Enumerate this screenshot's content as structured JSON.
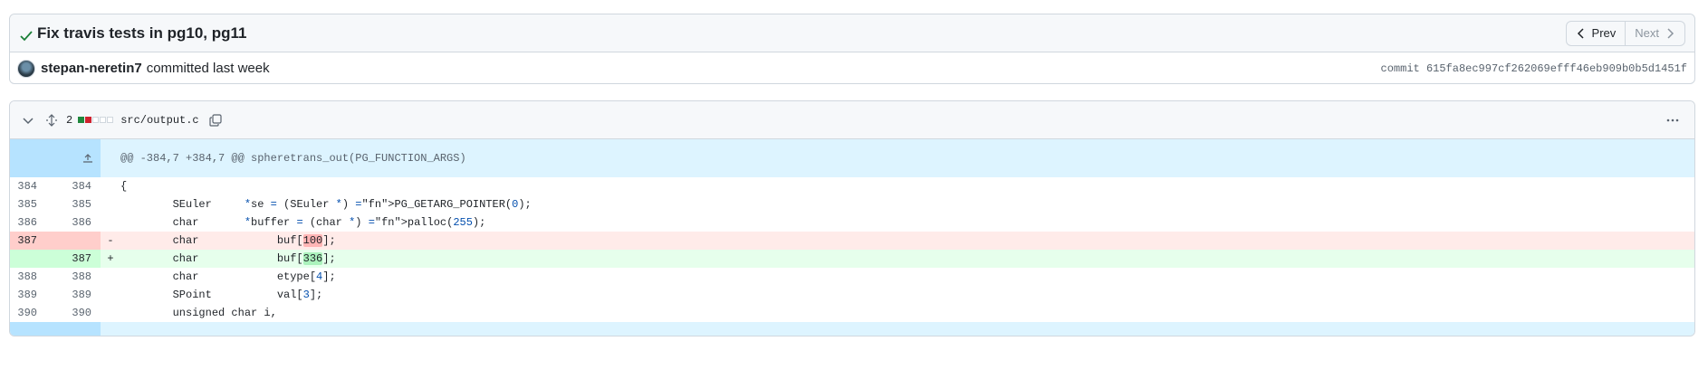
{
  "commit": {
    "title": "Fix travis tests in pg10, pg11",
    "prev_label": "Prev",
    "next_label": "Next",
    "author": "stepan-neretin7",
    "committed_text": "committed last week",
    "sha_label": "commit 615fa8ec997cf262069efff46eb909b0b5d1451f"
  },
  "file": {
    "change_count": "2",
    "name": "src/output.c",
    "diffstat": [
      "add",
      "del",
      "neutral",
      "neutral",
      "neutral"
    ]
  },
  "colors": {
    "add": "#1f883d",
    "del": "#cf222e",
    "neutral": "#d0d7de",
    "hunk_bg": "#ddf4ff",
    "check": "#1a7f37"
  },
  "diff": {
    "hunk_header": "@@ -384,7 +384,7 @@ spheretrans_out(PG_FUNCTION_ARGS)",
    "lines": [
      {
        "type": "ctx",
        "old": "384",
        "new": "384",
        "marker": "",
        "code": "{"
      },
      {
        "type": "ctx",
        "old": "385",
        "new": "385",
        "marker": "",
        "code": "        SEuler     *se = (SEuler *) PG_GETARG_POINTER(0);"
      },
      {
        "type": "ctx",
        "old": "386",
        "new": "386",
        "marker": "",
        "code": "        char       *buffer = (char *) palloc(255);"
      },
      {
        "type": "del",
        "old": "387",
        "new": "",
        "marker": "-",
        "code": "        char            buf[100];"
      },
      {
        "type": "add",
        "old": "",
        "new": "387",
        "marker": "+",
        "code": "        char            buf[336];"
      },
      {
        "type": "ctx",
        "old": "388",
        "new": "388",
        "marker": "",
        "code": "        char            etype[4];"
      },
      {
        "type": "ctx",
        "old": "389",
        "new": "389",
        "marker": "",
        "code": "        SPoint          val[3];"
      },
      {
        "type": "ctx",
        "old": "390",
        "new": "390",
        "marker": "",
        "code": "        unsigned char i,"
      }
    ]
  }
}
